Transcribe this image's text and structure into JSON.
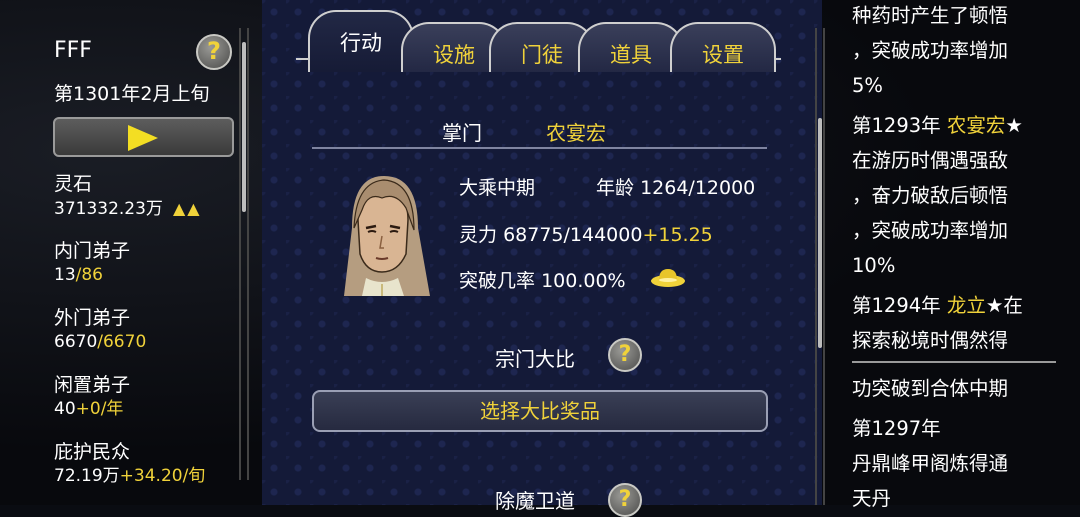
{
  "colors": {
    "accent": "#f0d23a",
    "panel": "#141a38",
    "text": "#ffffff"
  },
  "left": {
    "title": "FFF",
    "date": "第1301年2月上旬",
    "help_icon": "question-icon",
    "play_icon": "play-icon",
    "stats": [
      {
        "label": "灵石",
        "value": "371332.23万",
        "extra": "▲▲"
      },
      {
        "label": "内门弟子",
        "value": "13",
        "max": "/86"
      },
      {
        "label": "外门弟子",
        "value": "6670",
        "max": "/6670"
      },
      {
        "label": "闲置弟子",
        "value": "40",
        "rate": "+0/年"
      },
      {
        "label": "庇护民众",
        "value": "72.19万",
        "rate": "+34.20/旬"
      }
    ]
  },
  "tabs": [
    {
      "label": "行动",
      "active": true
    },
    {
      "label": "设施"
    },
    {
      "label": "门徒"
    },
    {
      "label": "道具"
    },
    {
      "label": "设置"
    }
  ],
  "leader": {
    "label": "掌门",
    "name": "农宴宏",
    "realm": "大乘中期",
    "age_label": "年龄",
    "age": "1264/12000",
    "power_label": "灵力",
    "power": "68775/144000",
    "power_rate": "+15.25",
    "breakthrough_label": "突破几率",
    "breakthrough": "100.00%"
  },
  "tournament": {
    "title": "宗门大比",
    "button": "选择大比奖品"
  },
  "next_section": {
    "title": "除魔卫道"
  },
  "log": {
    "lines": [
      {
        "text": "种药时产生了顿悟"
      },
      {
        "text": "，突破成功率增加"
      },
      {
        "text": "5%"
      },
      {
        "pre": "第1293年 ",
        "hl": "农宴宏",
        "post": "★"
      },
      {
        "text": "在游历时偶遇强敌"
      },
      {
        "text": "，奋力破敌后顿悟"
      },
      {
        "text": "，突破成功率增加"
      },
      {
        "text": "10%"
      },
      {
        "pre": "第1294年 ",
        "hl": "龙立",
        "post": "★在"
      },
      {
        "text": "探索秘境时偶然得"
      },
      {
        "text": "功突破到合体中期"
      },
      {
        "text": "第1297年"
      },
      {
        "text": "丹鼎峰甲阁炼得通"
      },
      {
        "text": "天丹"
      }
    ]
  }
}
